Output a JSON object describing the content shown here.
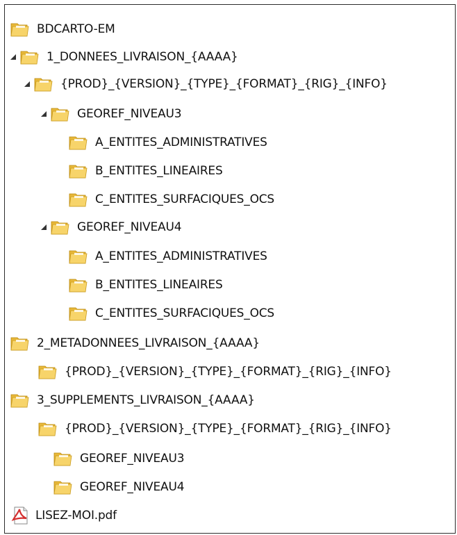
{
  "tree": {
    "items": [
      {
        "label": "BDCARTO-EM",
        "icon": "folder-icon",
        "expanded": null,
        "level": 0
      },
      {
        "label": "1_DONNEES_LIVRAISON_{AAAA}",
        "icon": "folder-icon",
        "expanded": true,
        "level": 0
      },
      {
        "label": "{PROD}_{VERSION}_{TYPE}_{FORMAT}_{RIG}_{INFO}",
        "icon": "folder-icon",
        "expanded": true,
        "level": 1
      },
      {
        "label": "GEOREF_NIVEAU3",
        "icon": "folder-icon",
        "expanded": true,
        "level": 2
      },
      {
        "label": "A_ENTITES_ADMINISTRATIVES",
        "icon": "folder-icon",
        "expanded": null,
        "level": 3
      },
      {
        "label": "B_ENTITES_LINEAIRES",
        "icon": "folder-icon",
        "expanded": null,
        "level": 3
      },
      {
        "label": "C_ENTITES_SURFACIQUES_OCS",
        "icon": "folder-icon",
        "expanded": null,
        "level": 3
      },
      {
        "label": "GEOREF_NIVEAU4",
        "icon": "folder-icon",
        "expanded": true,
        "level": 2
      },
      {
        "label": "A_ENTITES_ADMINISTRATIVES",
        "icon": "folder-icon",
        "expanded": null,
        "level": 3
      },
      {
        "label": "B_ENTITES_LINEAIRES",
        "icon": "folder-icon",
        "expanded": null,
        "level": 3
      },
      {
        "label": "C_ENTITES_SURFACIQUES_OCS",
        "icon": "folder-icon",
        "expanded": null,
        "level": 3
      },
      {
        "label": "2_METADONNEES_LIVRAISON_{AAAA}",
        "icon": "folder-icon",
        "expanded": null,
        "level": 0
      },
      {
        "label": "{PROD}_{VERSION}_{TYPE}_{FORMAT}_{RIG}_{INFO}",
        "icon": "folder-icon",
        "expanded": null,
        "level": 1
      },
      {
        "label": "3_SUPPLEMENTS_LIVRAISON_{AAAA}",
        "icon": "folder-icon",
        "expanded": null,
        "level": 0
      },
      {
        "label": "{PROD}_{VERSION}_{TYPE}_{FORMAT}_{RIG}_{INFO}",
        "icon": "folder-icon",
        "expanded": null,
        "level": 1
      },
      {
        "label": "GEOREF_NIVEAU3",
        "icon": "folder-icon",
        "expanded": null,
        "level": 2
      },
      {
        "label": "GEOREF_NIVEAU4",
        "icon": "folder-icon",
        "expanded": null,
        "level": 2
      },
      {
        "label": "LISEZ-MOI.pdf",
        "icon": "pdf-icon",
        "expanded": null,
        "level": 0
      }
    ]
  },
  "colors": {
    "folder_body": "#e8b83a",
    "folder_front": "#f7d46a",
    "arrow": "#333333",
    "pdf_red": "#d32f2f"
  }
}
